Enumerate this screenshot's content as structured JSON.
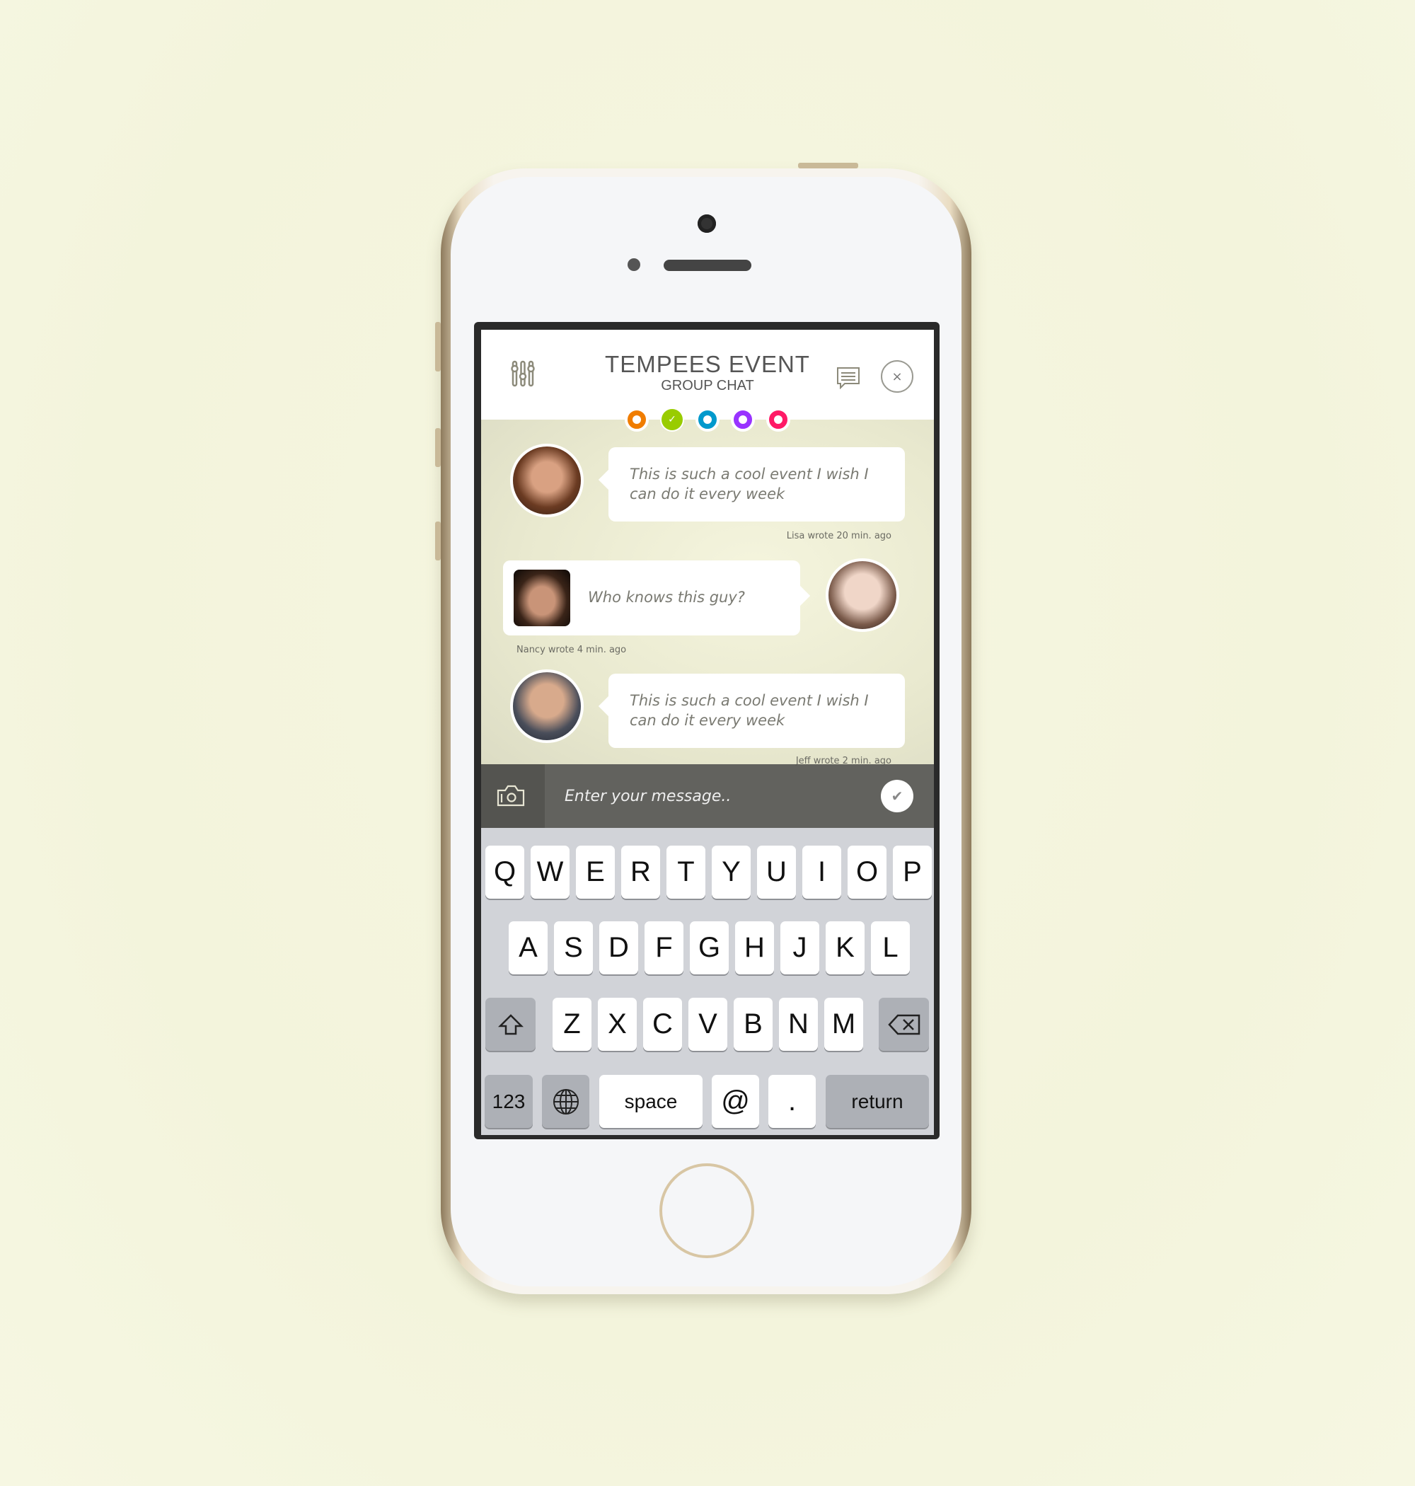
{
  "header": {
    "title": "TEMPEES EVENT",
    "subtitle": "GROUP CHAT",
    "icons": [
      "sliders-icon",
      "chat-list-icon",
      "close-icon"
    ]
  },
  "status_dots": [
    {
      "color": "#f07d00",
      "checked": false
    },
    {
      "color": "#99cc00",
      "checked": true
    },
    {
      "color": "#0099cc",
      "checked": false
    },
    {
      "color": "#9933ff",
      "checked": false
    },
    {
      "color": "#ff1a66",
      "checked": false
    }
  ],
  "messages": [
    {
      "text": "This is such a cool event I wish I can do it every week",
      "meta": "Lisa wrote 20 min. ago",
      "side": "left"
    },
    {
      "text": "Who knows this guy?",
      "meta": "Nancy wrote 4 min. ago",
      "side": "right"
    },
    {
      "text": "This is such a cool event I wish I can do it every week",
      "meta": "Jeff wrote 2 min. ago",
      "side": "left"
    }
  ],
  "input": {
    "placeholder": "Enter your message.."
  },
  "keyboard": {
    "row1": [
      "Q",
      "W",
      "E",
      "R",
      "T",
      "Y",
      "U",
      "I",
      "O",
      "P"
    ],
    "row2": [
      "A",
      "S",
      "D",
      "F",
      "G",
      "H",
      "J",
      "K",
      "L"
    ],
    "row3": [
      "Z",
      "X",
      "C",
      "V",
      "B",
      "N",
      "M"
    ],
    "numbers": "123",
    "space": "space",
    "at": "@",
    "dot": ".",
    "return": "return"
  }
}
